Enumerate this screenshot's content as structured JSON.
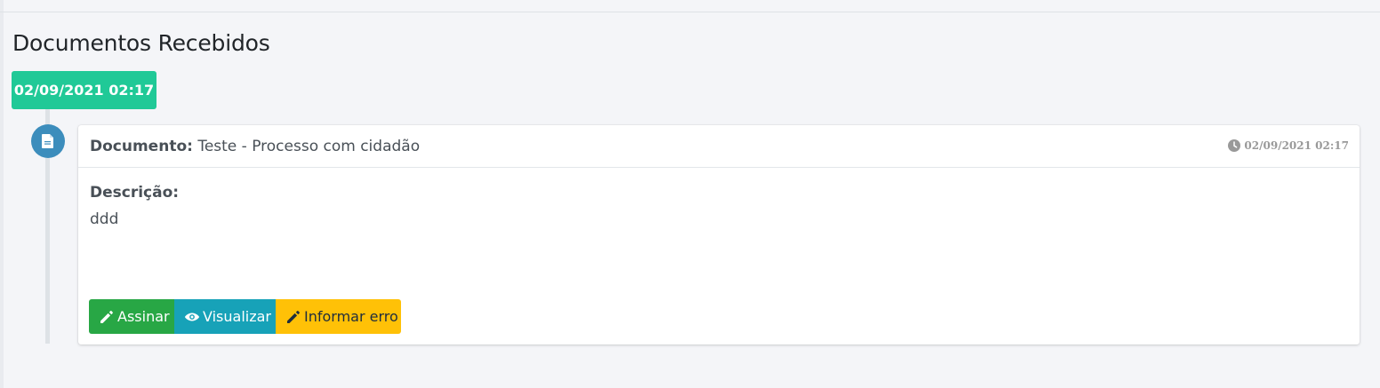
{
  "page": {
    "title": "Documentos Recebidos"
  },
  "timeline": {
    "date_label": "02/09/2021 02:17",
    "icon": "file-icon",
    "item": {
      "document_label": "Documento:",
      "document_name": "Teste - Processo com cidadão",
      "time_icon": "clock-icon",
      "time": "02/09/2021 02:17",
      "description_label": "Descrição:",
      "description_value": "ddd",
      "actions": [
        {
          "label": "Assinar",
          "icon": "pencil-icon",
          "color": "#28a745"
        },
        {
          "label": "Visualizar",
          "icon": "eye-icon",
          "color": "#17a2b8"
        },
        {
          "label": "Informar erro",
          "icon": "pencil-icon",
          "color": "#ffc107"
        }
      ]
    }
  },
  "colors": {
    "date_label_bg": "#20c997",
    "timeline_icon_bg": "#3c8dbc",
    "page_bg": "#f4f5f8"
  }
}
